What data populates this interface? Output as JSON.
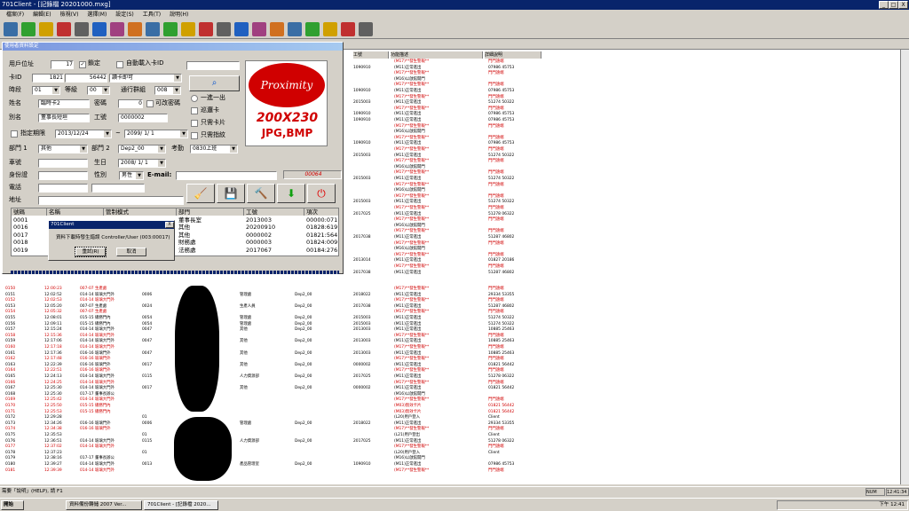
{
  "window": {
    "title": "701Client - [記錄檔 20201000.mxg]",
    "minimize": "_",
    "maximize": "□",
    "close": "X"
  },
  "menu": [
    "檔案(F)",
    "編輯(E)",
    "檢視(V)",
    "選擇(M)",
    "設定(S)",
    "工具(T)",
    "說明(H)"
  ],
  "toolbar_icons": [
    "open-icon",
    "badge-icon",
    "doc-icon",
    "print-icon",
    "refresh-icon",
    "calendar-icon",
    "grid-icon",
    "tool-icon",
    "chart-icon",
    "cut-icon",
    "clock-icon",
    "camera-icon",
    "power-icon",
    "door-icon",
    "tape-icon",
    "wrench-icon",
    "flag-icon",
    "pass-icon",
    "back-icon",
    "forward-icon",
    "help-icon"
  ],
  "grid": {
    "header": [
      "工號",
      "功能描述",
      "詳細說明"
    ],
    "top_rows": [
      {
        "a": "",
        "b": "(M17)**發生警報**",
        "c": "門門遠端",
        "red": true
      },
      {
        "a": "1090910",
        "b": "(M11)正常進出",
        "c": "07986 45753",
        "red": false
      },
      {
        "a": "",
        "b": "(M17)**發生警報**",
        "c": "門門遠端",
        "red": true
      },
      {
        "a": "",
        "b": "(M16)以啟館開門",
        "c": "",
        "red": false
      },
      {
        "a": "",
        "b": "(M17)**發生警報**",
        "c": "門門遠端",
        "red": true
      },
      {
        "a": "1090910",
        "b": "(M11)正常進出",
        "c": "07986 45753",
        "red": false
      },
      {
        "a": "",
        "b": "(M17)**發生警報**",
        "c": "門門遠端",
        "red": true
      },
      {
        "a": "2015003",
        "b": "(M11)正常進出",
        "c": "51274 50322",
        "red": false
      },
      {
        "a": "",
        "b": "(M17)**發生警報**",
        "c": "門門遠端",
        "red": true
      },
      {
        "a": "1090910",
        "b": "(M11)正常進出",
        "c": "07986 45753",
        "red": false
      },
      {
        "a": "1090910",
        "b": "(M11)正常進出",
        "c": "07986 45753",
        "red": false
      },
      {
        "a": "",
        "b": "(M17)**發生警報**",
        "c": "門門遠端",
        "red": true
      },
      {
        "a": "",
        "b": "(M16)以啟館開門",
        "c": "",
        "red": false
      },
      {
        "a": "",
        "b": "(M17)**發生警報**",
        "c": "門門遠端",
        "red": true
      },
      {
        "a": "1090910",
        "b": "(M11)正常進出",
        "c": "07986 45753",
        "red": false
      },
      {
        "a": "",
        "b": "(M17)**發生警報**",
        "c": "門門遠端",
        "red": true
      },
      {
        "a": "2015003",
        "b": "(M11)正常進出",
        "c": "51274 50322",
        "red": false
      },
      {
        "a": "",
        "b": "(M17)**發生警報**",
        "c": "門門遠端",
        "red": true
      },
      {
        "a": "",
        "b": "(M16)以啟館開門",
        "c": "",
        "red": false
      },
      {
        "a": "",
        "b": "(M17)**發生警報**",
        "c": "門門遠端",
        "red": true
      },
      {
        "a": "2015003",
        "b": "(M11)正常進出",
        "c": "51274 50322",
        "red": false
      },
      {
        "a": "",
        "b": "(M17)**發生警報**",
        "c": "門門遠端",
        "red": true
      },
      {
        "a": "",
        "b": "(M16)以啟館開門",
        "c": "",
        "red": false
      },
      {
        "a": "",
        "b": "(M17)**發生警報**",
        "c": "門門遠端",
        "red": true
      },
      {
        "a": "2015003",
        "b": "(M11)正常進出",
        "c": "51274 50322",
        "red": false
      },
      {
        "a": "",
        "b": "(M17)**發生警報**",
        "c": "門門遠端",
        "red": true
      },
      {
        "a": "2017025",
        "b": "(M11)正常進出",
        "c": "51278 06322",
        "red": false
      },
      {
        "a": "",
        "b": "(M17)**發生警報**",
        "c": "門門遠端",
        "red": true
      },
      {
        "a": "",
        "b": "(M16)以啟館開門",
        "c": "",
        "red": false
      },
      {
        "a": "",
        "b": "(M17)**發生警報**",
        "c": "門門遠端",
        "red": true
      },
      {
        "a": "2017038",
        "b": "(M11)正常進出",
        "c": "51287 46802",
        "red": false
      },
      {
        "a": "",
        "b": "(M17)**發生警報**",
        "c": "門門遠端",
        "red": true
      },
      {
        "a": "",
        "b": "(M16)以啟館開門",
        "c": "",
        "red": false
      },
      {
        "a": "",
        "b": "(M17)**發生警報**",
        "c": "門門遠端",
        "red": true
      },
      {
        "a": "2013014",
        "b": "(M11)正常進出",
        "c": "01827 20186",
        "red": false
      },
      {
        "a": "",
        "b": "(M17)**發生警報**",
        "c": "門門遠端",
        "red": true
      },
      {
        "a": "2017038",
        "b": "(M11)正常進出",
        "c": "51287 46802",
        "red": false
      }
    ],
    "rows": [
      {
        "n": "0150",
        "t": "12:00:23",
        "d": "007-07 生產處",
        "e": "",
        "f": "",
        "g": "",
        "h": "",
        "i": "(M17)**發生警報**",
        "j": "門門遠端",
        "red": true
      },
      {
        "n": "0151",
        "t": "12:02:52",
        "d": "014-14 玻璃大門外",
        "e": "0006",
        "f": "管理處",
        "g": "Dep2_00",
        "h": "2018022",
        "i": "(M11)正常進出",
        "j": "29334 53355",
        "red": false
      },
      {
        "n": "0152",
        "t": "12:02:53",
        "d": "014-14 玻璃大門外",
        "e": "",
        "f": "",
        "g": "",
        "h": "",
        "i": "(M17)**發生警報**",
        "j": "門門遠端",
        "red": true
      },
      {
        "n": "0153",
        "t": "12:05:20",
        "d": "007-07 生產處",
        "e": "0024",
        "f": "生產人員",
        "g": "Dep2_00",
        "h": "2017038",
        "i": "(M11)正常進出",
        "j": "51287 46802",
        "red": false
      },
      {
        "n": "0154",
        "t": "12:05:32",
        "d": "007-07 生產處",
        "e": "",
        "f": "",
        "g": "",
        "h": "",
        "i": "(M17)**發生警報**",
        "j": "門門遠端",
        "red": true
      },
      {
        "n": "0155",
        "t": "12:08:01",
        "d": "015-15 總務門內",
        "e": "0054",
        "f": "管理處",
        "g": "Dep2_00",
        "h": "2015003",
        "i": "(M11)正常進出",
        "j": "51274 50322",
        "red": false
      },
      {
        "n": "0156",
        "t": "12:09:11",
        "d": "015-15 總務門內",
        "e": "0054",
        "f": "管理處",
        "g": "Dep2_00",
        "h": "2015003",
        "i": "(M11)正常進出",
        "j": "51274 50322",
        "red": false
      },
      {
        "n": "0157",
        "t": "12:15:24",
        "d": "014-14 玻璃大門外",
        "e": "0047",
        "f": "其他",
        "g": "Dep2_00",
        "h": "2013003",
        "i": "(M11)正常進出",
        "j": "10885 25463",
        "red": false
      },
      {
        "n": "0158",
        "t": "12:15:36",
        "d": "014-14 玻璃大門外",
        "e": "",
        "f": "",
        "g": "",
        "h": "",
        "i": "(M17)**發生警報**",
        "j": "門門遠端",
        "red": true
      },
      {
        "n": "0159",
        "t": "12:17:06",
        "d": "014-14 玻璃大門外",
        "e": "0047",
        "f": "其他",
        "g": "Dep2_00",
        "h": "2013003",
        "i": "(M11)正常進出",
        "j": "10885 25463",
        "red": false
      },
      {
        "n": "0160",
        "t": "12:17:18",
        "d": "014-14 玻璃大門外",
        "e": "",
        "f": "",
        "g": "",
        "h": "",
        "i": "(M17)**發生警報**",
        "j": "門門遠端",
        "red": true
      },
      {
        "n": "0161",
        "t": "12:17:36",
        "d": "016-16 玻璃門外",
        "e": "0047",
        "f": "其他",
        "g": "Dep2_00",
        "h": "2013003",
        "i": "(M11)正常進出",
        "j": "10885 25463",
        "red": false
      },
      {
        "n": "0162",
        "t": "12:17:48",
        "d": "016-16 玻璃門外",
        "e": "",
        "f": "",
        "g": "",
        "h": "",
        "i": "(M17)**發生警報**",
        "j": "門門遠端",
        "red": true
      },
      {
        "n": "0163",
        "t": "12:22:39",
        "d": "016-16 玻璃門外",
        "e": "0017",
        "f": "其他",
        "g": "Dep2_00",
        "h": "0000002",
        "i": "(M11)正常進出",
        "j": "01821 56442",
        "red": false
      },
      {
        "n": "0164",
        "t": "12:22:51",
        "d": "016-16 玻璃門外",
        "e": "",
        "f": "",
        "g": "",
        "h": "",
        "i": "(M17)**發生警報**",
        "j": "門門遠端",
        "red": true
      },
      {
        "n": "0165",
        "t": "12:24:13",
        "d": "014-14 玻璃大門外",
        "e": "0115",
        "f": "人力資源部",
        "g": "Dep2_00",
        "h": "2017025",
        "i": "(M11)正常進出",
        "j": "51278 06322",
        "red": false
      },
      {
        "n": "0166",
        "t": "12:24:25",
        "d": "014-14 玻璃大門外",
        "e": "",
        "f": "",
        "g": "",
        "h": "",
        "i": "(M17)**發生警報**",
        "j": "門門遠端",
        "red": true
      },
      {
        "n": "0167",
        "t": "12:25:30",
        "d": "014-14 玻璃大門外",
        "e": "0017",
        "f": "其他",
        "g": "Dep2_00",
        "h": "0000002",
        "i": "(M11)正常進出",
        "j": "01821 56442",
        "red": false
      },
      {
        "n": "0168",
        "t": "12:25:30",
        "d": "017-17 董事長辦公",
        "e": "",
        "f": "",
        "g": "",
        "h": "",
        "i": "(M16)以啟館開門",
        "j": "",
        "red": false
      },
      {
        "n": "0169",
        "t": "12:25:42",
        "d": "014-14 玻璃大門外",
        "e": "",
        "f": "",
        "g": "",
        "h": "",
        "i": "(M17)**發生警報**",
        "j": "門門遠端",
        "red": true
      },
      {
        "n": "0170",
        "t": "12:25:50",
        "d": "015-15 總務門內",
        "e": "",
        "f": "",
        "g": "",
        "h": "",
        "i": "(M03)無效卡片",
        "j": "01821 56442",
        "red": true
      },
      {
        "n": "0171",
        "t": "12:25:53",
        "d": "015-15 總務門內",
        "e": "",
        "f": "",
        "g": "",
        "h": "",
        "i": "(M03)無效卡片",
        "j": "01821 56442",
        "red": true
      },
      {
        "n": "0172",
        "t": "12:29:28",
        "d": "",
        "e": "01",
        "f": "",
        "g": "",
        "h": "",
        "i": "(L20)用戶登入",
        "j": "Client",
        "red": false
      },
      {
        "n": "0173",
        "t": "12:34:26",
        "d": "016-16 玻璃門外",
        "e": "0006",
        "f": "管理處",
        "g": "Dep2_00",
        "h": "2018022",
        "i": "(M11)正常進出",
        "j": "29334 53355",
        "red": false
      },
      {
        "n": "0174",
        "t": "12:34:38",
        "d": "016-16 玻璃門外",
        "e": "",
        "f": "",
        "g": "",
        "h": "",
        "i": "(M17)**發生警報**",
        "j": "門門遠端",
        "red": true
      },
      {
        "n": "0175",
        "t": "12:35:53",
        "d": "",
        "e": "01",
        "f": "",
        "g": "",
        "h": "",
        "i": "(L21)用戶登出",
        "j": "Client",
        "red": false
      },
      {
        "n": "0176",
        "t": "12:36:51",
        "d": "014-14 玻璃大門外",
        "e": "0115",
        "f": "人力資源部",
        "g": "Dep2_00",
        "h": "2017025",
        "i": "(M11)正常進出",
        "j": "51278 06322",
        "red": false
      },
      {
        "n": "0177",
        "t": "12:37:02",
        "d": "014-14 玻璃大門外",
        "e": "",
        "f": "",
        "g": "",
        "h": "",
        "i": "(M17)**發生警報**",
        "j": "門門遠端",
        "red": true
      },
      {
        "n": "0178",
        "t": "12:37:23",
        "d": "",
        "e": "01",
        "f": "",
        "g": "",
        "h": "",
        "i": "(L20)用戶登入",
        "j": "Client",
        "red": false
      },
      {
        "n": "0179",
        "t": "12:38:16",
        "d": "017-17 董事長辦公",
        "e": "",
        "f": "",
        "g": "",
        "h": "",
        "i": "(M16)以啟館開門",
        "j": "",
        "red": false
      },
      {
        "n": "0180",
        "t": "12:39:27",
        "d": "014-14 玻璃大門外",
        "e": "0013",
        "f": "產品管理室",
        "g": "Dep2_00",
        "h": "1090910",
        "i": "(M11)正常進出",
        "j": "07986 45753",
        "red": false
      },
      {
        "n": "0181",
        "t": "12:39:39",
        "d": "014-14 玻璃大門外",
        "e": "",
        "f": "",
        "g": "",
        "h": "",
        "i": "(M17)**發生警報**",
        "j": "門門遠端",
        "red": true
      }
    ]
  },
  "dialog": {
    "title": "使用者資料設定",
    "labels": {
      "user_addr": "用戶位址",
      "card_id": "卡ID",
      "period": "時段",
      "name": "姓名",
      "alias": "別名",
      "expiry": "指定期限",
      "dept1": "部門 1",
      "dept2": "部門 2",
      "car": "車號",
      "birthday": "生日",
      "id_number": "身份證",
      "gender": "性別",
      "phone": "電話",
      "address": "地址",
      "level": "等級",
      "password": "密碼",
      "employee_id": "工號",
      "passage_group": "通行群組",
      "attendance": "考勤",
      "email": "E-mail:"
    },
    "values": {
      "user_addr": "17",
      "lock_label": "鎖定",
      "auto_load_label": "自動載入卡ID",
      "card_a": "1821",
      "card_b": "56442",
      "card_mode": "讀卡即可",
      "period": "01",
      "level": "00",
      "passage_group": "008",
      "name": "臨時卡2",
      "password": "0",
      "editable_pwd": "可改密碼",
      "alias": "董事長短垣",
      "employee_id": "0000002",
      "date_from": "2013/12/24",
      "date_sep": "~",
      "date_to": "2099/ 1/ 1",
      "dept1": "其他",
      "dept2": "Dep2_00",
      "attendance": "0830上班",
      "birthday": "2008/ 1/ 1",
      "gender": "男性",
      "counter": "00064"
    },
    "options": {
      "o1": "一進一出",
      "o2": "巡邏卡",
      "o3": "只需卡片",
      "o4": "只需指紋"
    },
    "proximity": {
      "logo": "Proximity",
      "size": "200X230",
      "format": "JPG,BMP"
    },
    "table": {
      "headers": [
        "號碼",
        "名稱",
        "管制模式",
        "部門",
        "工號",
        "項次"
      ],
      "rows": [
        [
          "0001",
          "",
          "",
          "董事長室",
          "2013003",
          "00000:071"
        ],
        [
          "0016",
          "",
          "",
          "其他",
          "20200910",
          "01828:619"
        ],
        [
          "0017",
          "",
          "",
          "其他",
          "0000002",
          "01821:564"
        ],
        [
          "0018",
          "",
          "",
          "財務處",
          "0000003",
          "01824:009"
        ],
        [
          "0019",
          "",
          "",
          "法務處",
          "2017067",
          "00184:276"
        ]
      ]
    }
  },
  "msgbox": {
    "title": "701Client",
    "close": "X",
    "message": "資料下載時發生錯誤 Controller/User (003:00017)",
    "retry": "重試(R)",
    "cancel": "取消"
  },
  "status": {
    "help": "需要「說明」(HELP), 請 F1",
    "num": "NUM",
    "time": "12:41:34"
  },
  "taskbar": {
    "start": "開始",
    "task1": "資料備份轉儲 2007 Ver...",
    "task2": "701Client - [記錄檔 2020...",
    "clock": "下午 12:41"
  }
}
